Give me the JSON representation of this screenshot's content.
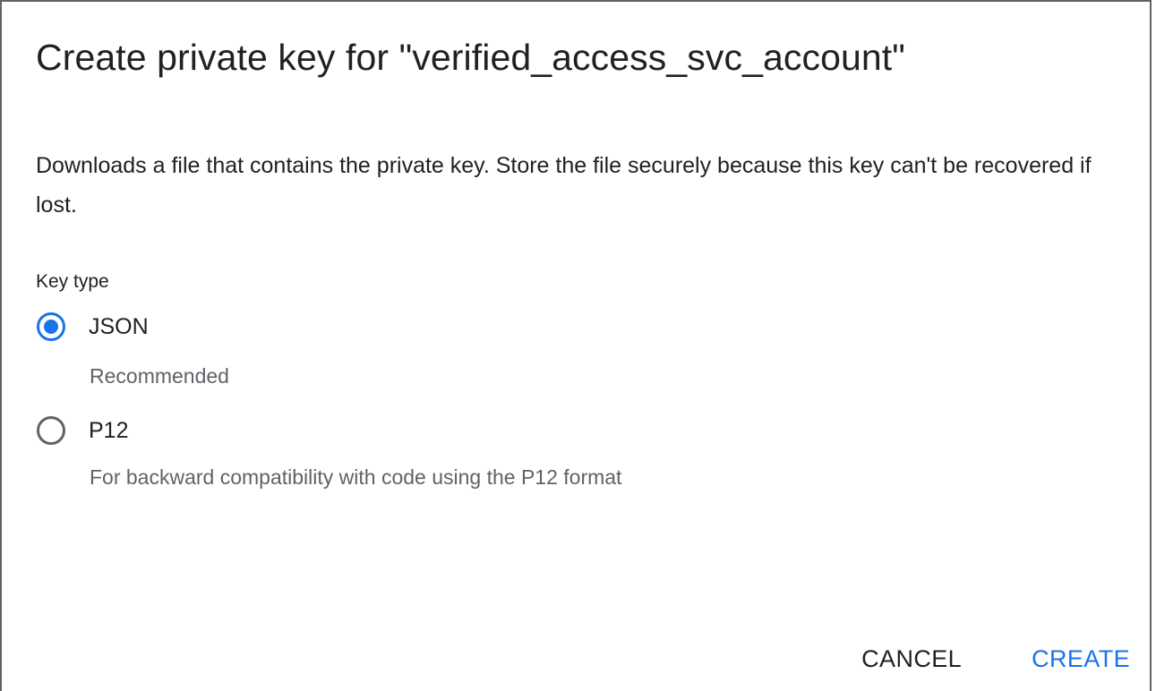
{
  "dialog": {
    "title": "Create private key for \"verified_access_svc_account\"",
    "description": "Downloads a file that contains the private key. Store the file securely because this key can't be recovered if lost.",
    "key_type_label": "Key type",
    "options": [
      {
        "label": "JSON",
        "helper": "Recommended",
        "selected": true
      },
      {
        "label": "P12",
        "helper": "For backward compatibility with code using the P12 format",
        "selected": false
      }
    ],
    "actions": {
      "cancel_label": "CANCEL",
      "create_label": "CREATE"
    }
  },
  "colors": {
    "accent": "#1a73e8",
    "text_primary": "#202124",
    "text_secondary": "#5f6368",
    "radio_unselected": "#5f6368"
  },
  "icons": {
    "radio_selected": "radio-selected-icon",
    "radio_unselected": "radio-unselected-icon"
  }
}
